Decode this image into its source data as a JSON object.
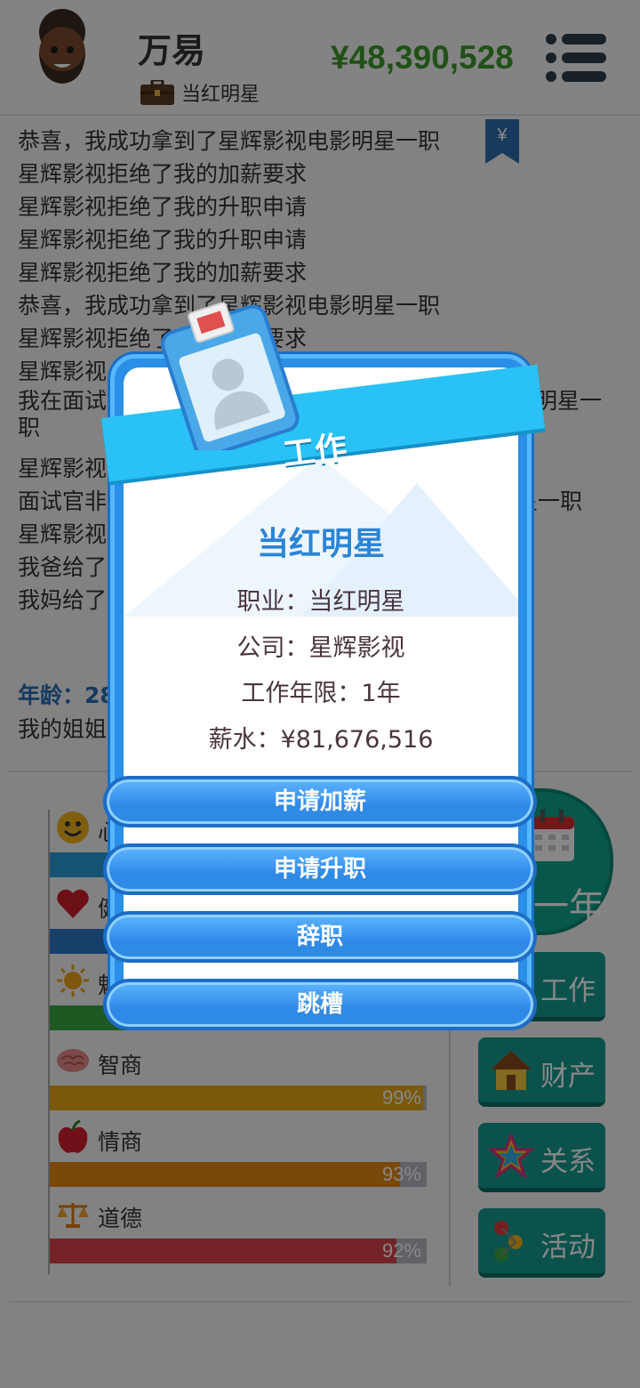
{
  "header": {
    "player_name": "万易",
    "job_title": "当红明星",
    "money": "¥48,390,528"
  },
  "log": [
    "恭喜，我成功拿到了星辉影视电影明星一职",
    "星辉影视拒绝了我的加薪要求",
    "星辉影视拒绝了我的升职申请",
    "星辉影视拒绝了我的升职申请",
    "星辉影视拒绝了我的加薪要求",
    "恭喜，我成功拿到了星辉影视电影明星一职",
    "星辉影视拒绝了我的加薪要求",
    "星辉影视"
  ],
  "log_fragments": {
    "interview_start": "我在面试",
    "interview_end": "明星一",
    "interview_wrap": "职",
    "line_a": "星辉影视",
    "line_b_start": "面试官非",
    "line_b_end": "星一职",
    "line_c": "星辉影视",
    "line_d": "我爸给了",
    "line_e": "我妈给了"
  },
  "age": {
    "label": "年龄：28",
    "desc": "我的姐姐"
  },
  "stats": [
    {
      "name": "心",
      "value": 0.95,
      "color": "#2a9bd6",
      "icon": "smile-icon"
    },
    {
      "name": "健",
      "value": 0.96,
      "color": "#2a78c8",
      "icon": "heart-icon"
    },
    {
      "name": "魅",
      "value": 0.97,
      "color": "#3aa845",
      "icon": "sun-icon"
    },
    {
      "name": "智商",
      "value": 0.99,
      "pct": "99%",
      "color": "#e6a817",
      "icon": "brain-icon"
    },
    {
      "name": "情商",
      "value": 0.93,
      "pct": "93%",
      "color": "#e58a14",
      "icon": "apple-icon"
    },
    {
      "name": "道德",
      "value": 0.92,
      "pct": "92%",
      "color": "#d9434b",
      "icon": "scales-icon"
    }
  ],
  "side": {
    "year_label": "一年",
    "work_label": "工作",
    "assets_label": "财产",
    "relations_label": "关系",
    "activities_label": "活动"
  },
  "dialog": {
    "banner": "工作",
    "title": "当红明星",
    "occupation": "职业：当红明星",
    "company": "公司：星辉影视",
    "years": "工作年限：1年",
    "salary": "薪水：¥81,676,516",
    "btn_raise": "申请加薪",
    "btn_promote": "申请升职",
    "btn_resign": "辞职",
    "btn_jobhop": "跳槽"
  }
}
